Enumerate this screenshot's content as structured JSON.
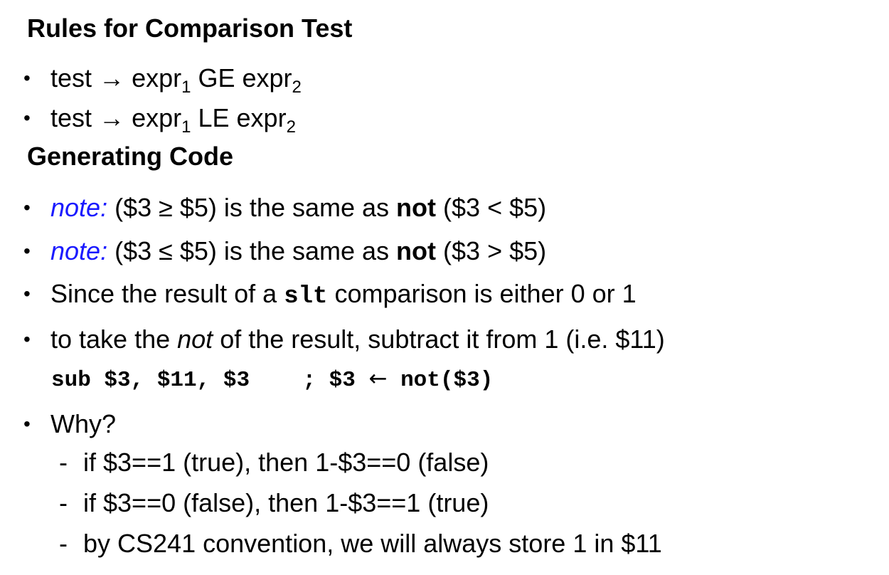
{
  "section1": {
    "heading": "Rules for Comparison Test",
    "rules": [
      {
        "lhs": "test",
        "arrow": "→",
        "expr1": "expr",
        "sub1": "1",
        "op": "GE",
        "expr2": "expr",
        "sub2": "2"
      },
      {
        "lhs": "test",
        "arrow": "→",
        "expr1": "expr",
        "sub1": "1",
        "op": "LE",
        "expr2": "expr",
        "sub2": "2"
      }
    ]
  },
  "section2": {
    "heading": "Generating Code",
    "notes": [
      {
        "label": "note:",
        "pre": "($3 ≥ $5) is the same as",
        "bold": "not",
        "post": "($3 < $5)"
      },
      {
        "label": "note:",
        "pre": "($3 ≤ $5) is the same as",
        "bold": "not",
        "post": "($3 > $5)"
      }
    ],
    "slt_line": {
      "pre": "Since the result of a",
      "code": "slt",
      "post": "comparison is either 0 or 1"
    },
    "not_line": {
      "pre": "to take the",
      "italic": "not",
      "post": "of the result, subtract it from 1 (i.e. $11)"
    },
    "code": {
      "instr": "sub $3, $11, $3    ; $3",
      "arrow": "←",
      "rest": "not($3)"
    },
    "why": {
      "label": "Why?",
      "items": [
        "if $3==1 (true), then 1-$3==0 (false)",
        "if $3==0 (false), then 1-$3==1 (true)",
        "by CS241 convention, we will always store 1 in $11"
      ]
    }
  }
}
